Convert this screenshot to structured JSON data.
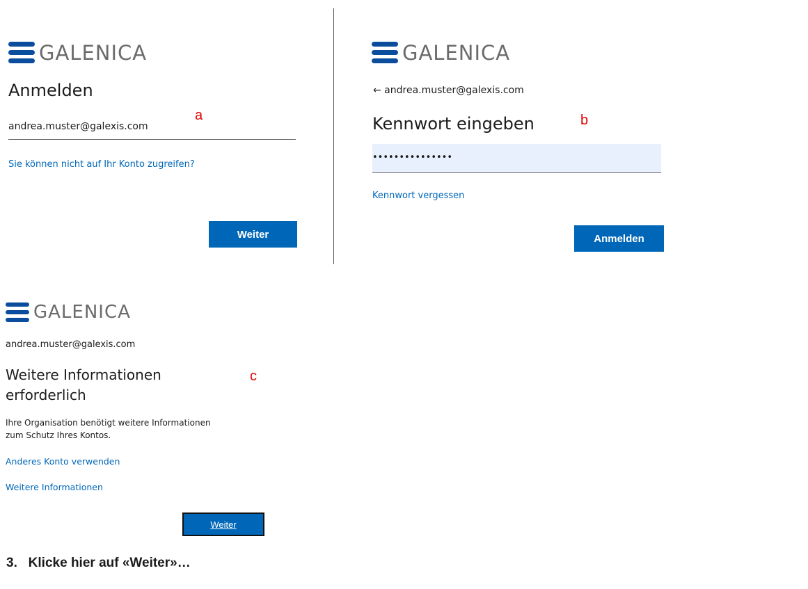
{
  "logo_text": "GALENICA",
  "panel_a": {
    "heading": "Anmelden",
    "email_value": "andrea.muster@galexis.com",
    "help_link": "Sie können nicht auf Ihr Konto zugreifen?",
    "next_button": "Weiter",
    "marker": "a"
  },
  "panel_b": {
    "back_email": "← andrea.muster@galexis.com",
    "heading": "Kennwort eingeben",
    "password_mask": "•••••••••••••••",
    "forgot_link": "Kennwort vergessen",
    "signin_button": "Anmelden",
    "marker": "b"
  },
  "panel_c": {
    "email": "andrea.muster@galexis.com",
    "heading_line1": "Weitere Informationen",
    "heading_line2": "erforderlich",
    "body_line1": "Ihre Organisation benötigt weitere Informationen",
    "body_line2": "zum Schutz Ihres Kontos.",
    "other_account_link": "Anderes Konto verwenden",
    "more_info_link": "Weitere Informationen",
    "next_button": "Weiter",
    "marker": "c"
  },
  "instruction": "3.   Klicke hier auf «Weiter»…",
  "colors": {
    "brand": "#0a4d9c",
    "button": "#0067b8",
    "link": "#0067b8",
    "marker": "#e00000"
  }
}
